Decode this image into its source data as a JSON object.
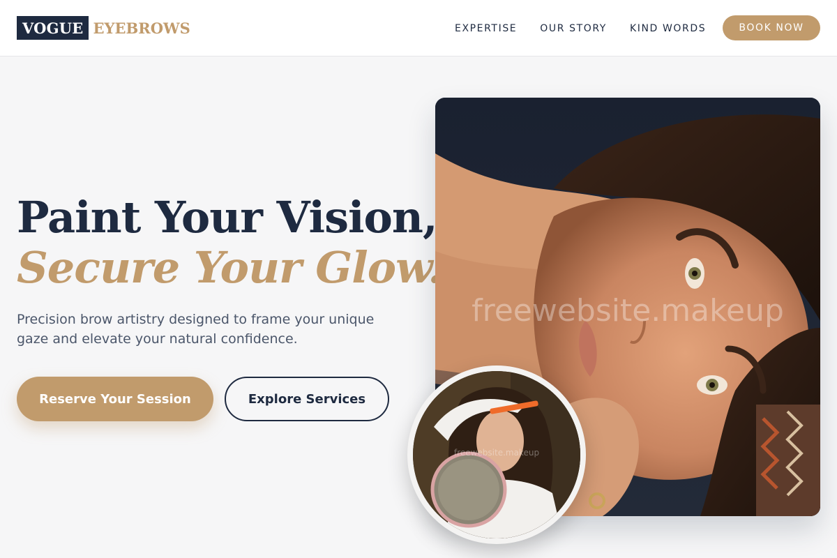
{
  "brand": {
    "name_primary": "VOGUE",
    "name_accent": "EYEBROWS"
  },
  "nav": {
    "items": [
      {
        "label": "EXPERTISE"
      },
      {
        "label": "OUR STORY"
      },
      {
        "label": "KIND WORDS"
      }
    ],
    "cta": "BOOK NOW"
  },
  "hero": {
    "title_line1": "Paint Your Vision,",
    "title_line2": "Secure Your Glow.",
    "description": "Precision brow artistry designed to frame your unique gaze and elevate your natural confidence.",
    "primary_button": "Reserve Your Session",
    "secondary_button": "Explore Services"
  },
  "images": {
    "main_watermark": "freewebsite.makeup",
    "inset_watermark": "freewebsite.makeup"
  },
  "colors": {
    "navy": "#1e2a40",
    "gold": "#c19b6c",
    "background": "#f6f6f7"
  }
}
